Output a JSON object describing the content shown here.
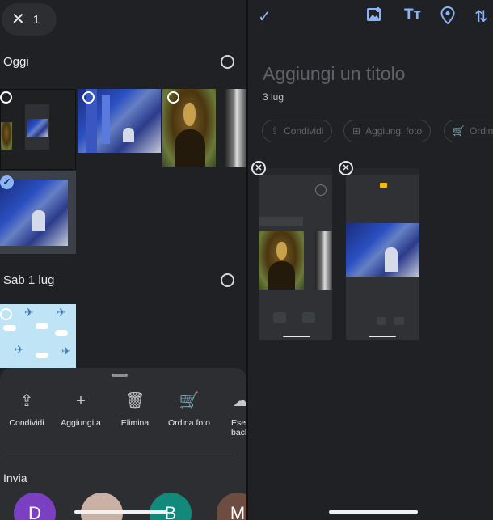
{
  "left": {
    "selection_count": "1",
    "sections": [
      {
        "title": "Oggi"
      },
      {
        "title": "Sab 1 lug"
      }
    ],
    "actions": [
      {
        "label": "Condividi",
        "icon": "share-icon"
      },
      {
        "label": "Aggiungi a",
        "icon": "plus-icon"
      },
      {
        "label": "Elimina",
        "icon": "trash-icon"
      },
      {
        "label": "Ordina foto",
        "icon": "cart-icon"
      },
      {
        "label": "Eseg back",
        "icon": "backup-icon"
      }
    ],
    "send_title": "Invia",
    "contacts": [
      {
        "initial": "D",
        "color": "#7b3fc2"
      },
      {
        "initial": "",
        "color": "#c9b1a6"
      },
      {
        "initial": "B",
        "color": "#13897b"
      },
      {
        "initial": "M",
        "color": "#6d4c41"
      }
    ]
  },
  "right": {
    "title_placeholder": "Aggiungi un titolo",
    "date": "3 lug",
    "chips": [
      {
        "label": "Condividi",
        "icon": "share-icon"
      },
      {
        "label": "Aggiungi foto",
        "icon": "add-photo-icon"
      },
      {
        "label": "Ordina",
        "icon": "cart-icon"
      }
    ],
    "toolbar_icons": [
      "check-icon",
      "image-icon",
      "text-icon",
      "location-icon",
      "sort-icon"
    ],
    "accent": "#8ab4f8"
  }
}
